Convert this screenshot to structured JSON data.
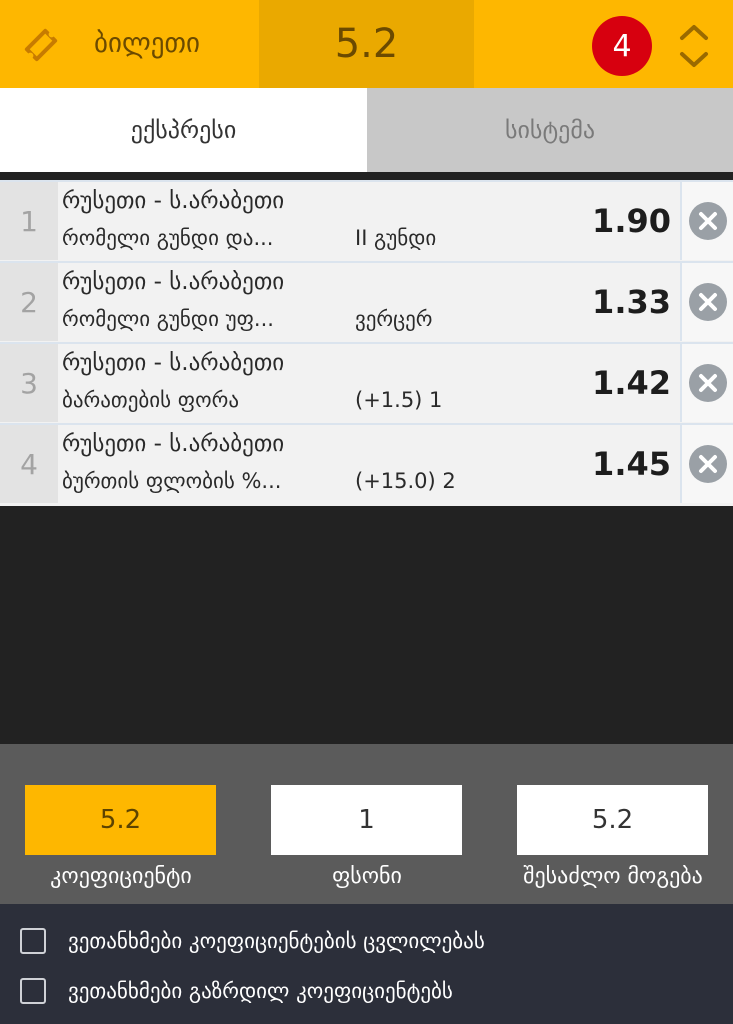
{
  "header": {
    "ticket_label": "ბილეთი",
    "total_odds": "5.2",
    "bet_count": "4"
  },
  "tabs": [
    {
      "label": "ექსპრესი",
      "active": true
    },
    {
      "label": "სისტემა",
      "active": false
    }
  ],
  "bets": [
    {
      "num": "1",
      "match": "რუსეთი - ს.არაბეთი",
      "market": "რომელი გუნდი და...",
      "outcome": "II გუნდი",
      "odds": "1.90"
    },
    {
      "num": "2",
      "match": "რუსეთი - ს.არაბეთი",
      "market": "რომელი გუნდი უფ...",
      "outcome": "ვერცერ",
      "odds": "1.33"
    },
    {
      "num": "3",
      "match": "რუსეთი - ს.არაბეთი",
      "market": "ბარათების ფორა",
      "outcome": "(+1.5) 1",
      "odds": "1.42"
    },
    {
      "num": "4",
      "match": "რუსეთი - ს.არაბეთი",
      "market": "ბურთის ფლობის %...",
      "outcome": "(+15.0) 2",
      "odds": "1.45"
    }
  ],
  "summary": {
    "odds_value": "5.2",
    "odds_label": "კოეფიციენტი",
    "stake_value": "1",
    "stake_label": "ფსონი",
    "win_value": "5.2",
    "win_label": "შესაძლო მოგება"
  },
  "agreements": [
    {
      "label": "ვეთანხმები კოეფიციენტების ცვლილებას",
      "checked": false
    },
    {
      "label": "ვეთანხმები გაზრდილ კოეფიციენტებს",
      "checked": false
    }
  ],
  "colors": {
    "accent": "#FEB700",
    "accent_dark": "#EAA900",
    "badge": "#D7000F",
    "summary_bg": "#5B5B5B",
    "footer_bg": "#2C2F3A"
  }
}
